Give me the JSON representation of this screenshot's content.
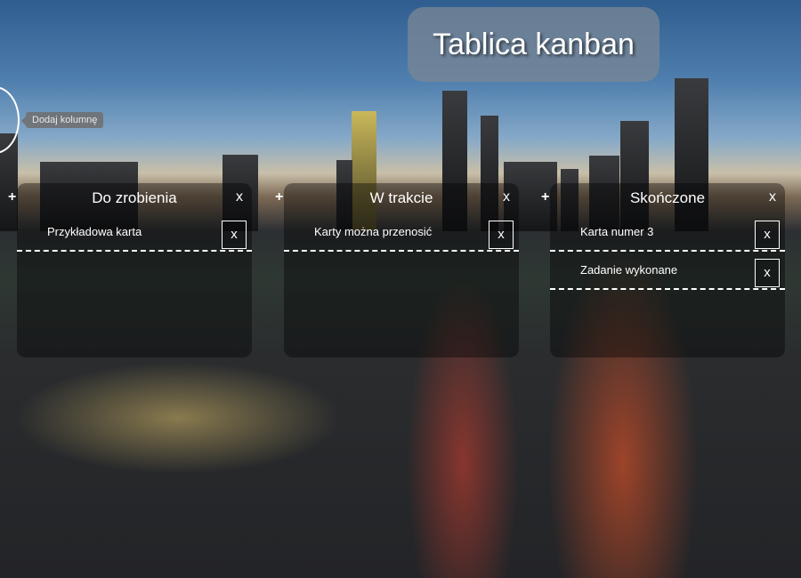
{
  "header": {
    "title": "Tablica kanban"
  },
  "add_column": {
    "tooltip": "Dodaj kolumnę"
  },
  "columns": [
    {
      "title": "Do zrobienia",
      "add_label": "+",
      "close_label": "x",
      "cards": [
        {
          "text": "Przykładowa karta",
          "delete_label": "x"
        }
      ]
    },
    {
      "title": "W trakcie",
      "add_label": "+",
      "close_label": "x",
      "cards": [
        {
          "text": "Karty można przenosić",
          "delete_label": "x"
        }
      ]
    },
    {
      "title": "Skończone",
      "add_label": "+",
      "close_label": "x",
      "cards": [
        {
          "text": "Karta numer 3",
          "delete_label": "x"
        },
        {
          "text": "Zadanie wykonane",
          "delete_label": "x"
        }
      ]
    }
  ]
}
